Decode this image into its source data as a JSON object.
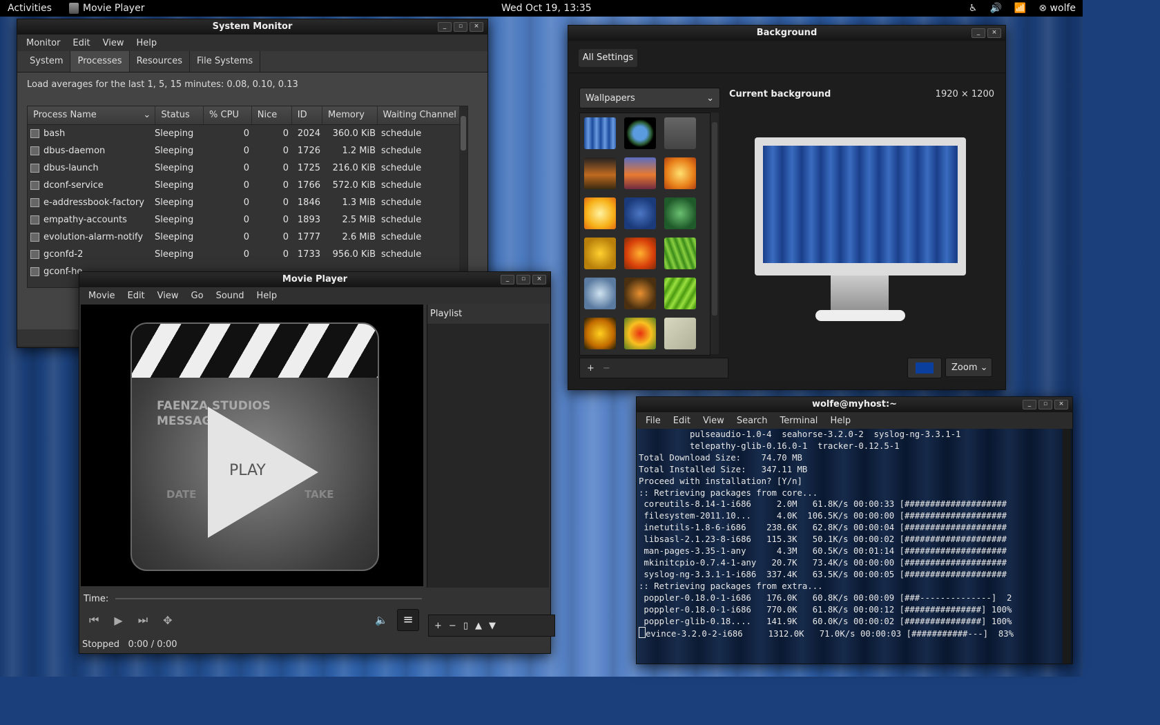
{
  "topbar": {
    "activities": "Activities",
    "app_name": "Movie Player",
    "clock": "Wed Oct 19, 13:35",
    "user": "wolfe",
    "icons": [
      "accessibility-icon",
      "volume-icon",
      "wifi-icon",
      "user-icon"
    ]
  },
  "sysmon": {
    "title": "System Monitor",
    "menu": [
      "Monitor",
      "Edit",
      "View",
      "Help"
    ],
    "tabs": [
      "System",
      "Processes",
      "Resources",
      "File Systems"
    ],
    "active_tab": "Processes",
    "load_averages": "Load averages for the last 1, 5, 15 minutes: 0.08, 0.10, 0.13",
    "columns": [
      "Process Name",
      "Status",
      "% CPU",
      "Nice",
      "ID",
      "Memory",
      "Waiting Channel"
    ],
    "rows": [
      {
        "name": "bash",
        "status": "Sleeping",
        "cpu": "0",
        "nice": "0",
        "id": "2024",
        "memory": "360.0 KiB",
        "wait": "schedule"
      },
      {
        "name": "dbus-daemon",
        "status": "Sleeping",
        "cpu": "0",
        "nice": "0",
        "id": "1726",
        "memory": "1.2 MiB",
        "wait": "schedule"
      },
      {
        "name": "dbus-launch",
        "status": "Sleeping",
        "cpu": "0",
        "nice": "0",
        "id": "1725",
        "memory": "216.0 KiB",
        "wait": "schedule"
      },
      {
        "name": "dconf-service",
        "status": "Sleeping",
        "cpu": "0",
        "nice": "0",
        "id": "1766",
        "memory": "572.0 KiB",
        "wait": "schedule"
      },
      {
        "name": "e-addressbook-factory",
        "status": "Sleeping",
        "cpu": "0",
        "nice": "0",
        "id": "1846",
        "memory": "1.3 MiB",
        "wait": "schedule"
      },
      {
        "name": "empathy-accounts",
        "status": "Sleeping",
        "cpu": "0",
        "nice": "0",
        "id": "1893",
        "memory": "2.5 MiB",
        "wait": "schedule"
      },
      {
        "name": "evolution-alarm-notify",
        "status": "Sleeping",
        "cpu": "0",
        "nice": "0",
        "id": "1777",
        "memory": "2.6 MiB",
        "wait": "schedule"
      },
      {
        "name": "gconfd-2",
        "status": "Sleeping",
        "cpu": "0",
        "nice": "0",
        "id": "1733",
        "memory": "956.0 KiB",
        "wait": "schedule"
      },
      {
        "name": "gconf-he",
        "status": "",
        "cpu": "",
        "nice": "",
        "id": "",
        "memory": "",
        "wait": ""
      }
    ]
  },
  "movie": {
    "title": "Movie Player",
    "menu": [
      "Movie",
      "Edit",
      "View",
      "Go",
      "Sound",
      "Help"
    ],
    "playlist_header": "Playlist",
    "clapper_text1": "FAENZA STUDIOS",
    "clapper_text2": "MESSAG",
    "play_word": "PLAY",
    "clapper_bottom_left": "DATE",
    "clapper_bottom_right": "TAKE",
    "time_label": "Time:",
    "status": "Stopped",
    "time_value": "0:00 / 0:00"
  },
  "background": {
    "title": "Background",
    "all_settings": "All Settings",
    "wallpaper_select": "Wallpapers",
    "current_label": "Current background",
    "resolution": "1920 × 1200",
    "zoom": "Zoom",
    "accent_color": "#0a3f9e"
  },
  "terminal": {
    "title": "wolfe@myhost:~",
    "menu": [
      "File",
      "Edit",
      "View",
      "Search",
      "Terminal",
      "Help"
    ],
    "lines": [
      "          pulseaudio-1.0-4  seahorse-3.2.0-2  syslog-ng-3.3.1-1",
      "          telepathy-glib-0.16.0-1  tracker-0.12.5-1",
      "",
      "Total Download Size:    74.70 MB",
      "Total Installed Size:   347.11 MB",
      "",
      "Proceed with installation? [Y/n]",
      ":: Retrieving packages from core...",
      " coreutils-8.14-1-i686     2.0M   61.8K/s 00:00:33 [####################",
      " filesystem-2011.10...     4.0K  106.5K/s 00:00:00 [####################",
      " inetutils-1.8-6-i686    238.6K   62.8K/s 00:00:04 [####################",
      " libsasl-2.1.23-8-i686   115.3K   50.1K/s 00:00:02 [####################",
      " man-pages-3.35-1-any      4.3M   60.5K/s 00:01:14 [####################",
      " mkinitcpio-0.7.4-1-any   20.7K   73.4K/s 00:00:00 [####################",
      " syslog-ng-3.3.1-1-i686  337.4K   63.5K/s 00:00:05 [####################",
      ":: Retrieving packages from extra...",
      " poppler-0.18.0-1-i686   176.0K   60.8K/s 00:00:09 [###--------------]  2",
      " poppler-0.18.0-1-i686   770.0K   61.8K/s 00:00:12 [###############] 100%",
      " poppler-glib-0.18....   141.9K   60.0K/s 00:00:02 [###############] 100%",
      "evince-3.2.0-2-i686     1312.0K   71.0K/s 00:00:03 [###########---]  83%"
    ]
  }
}
